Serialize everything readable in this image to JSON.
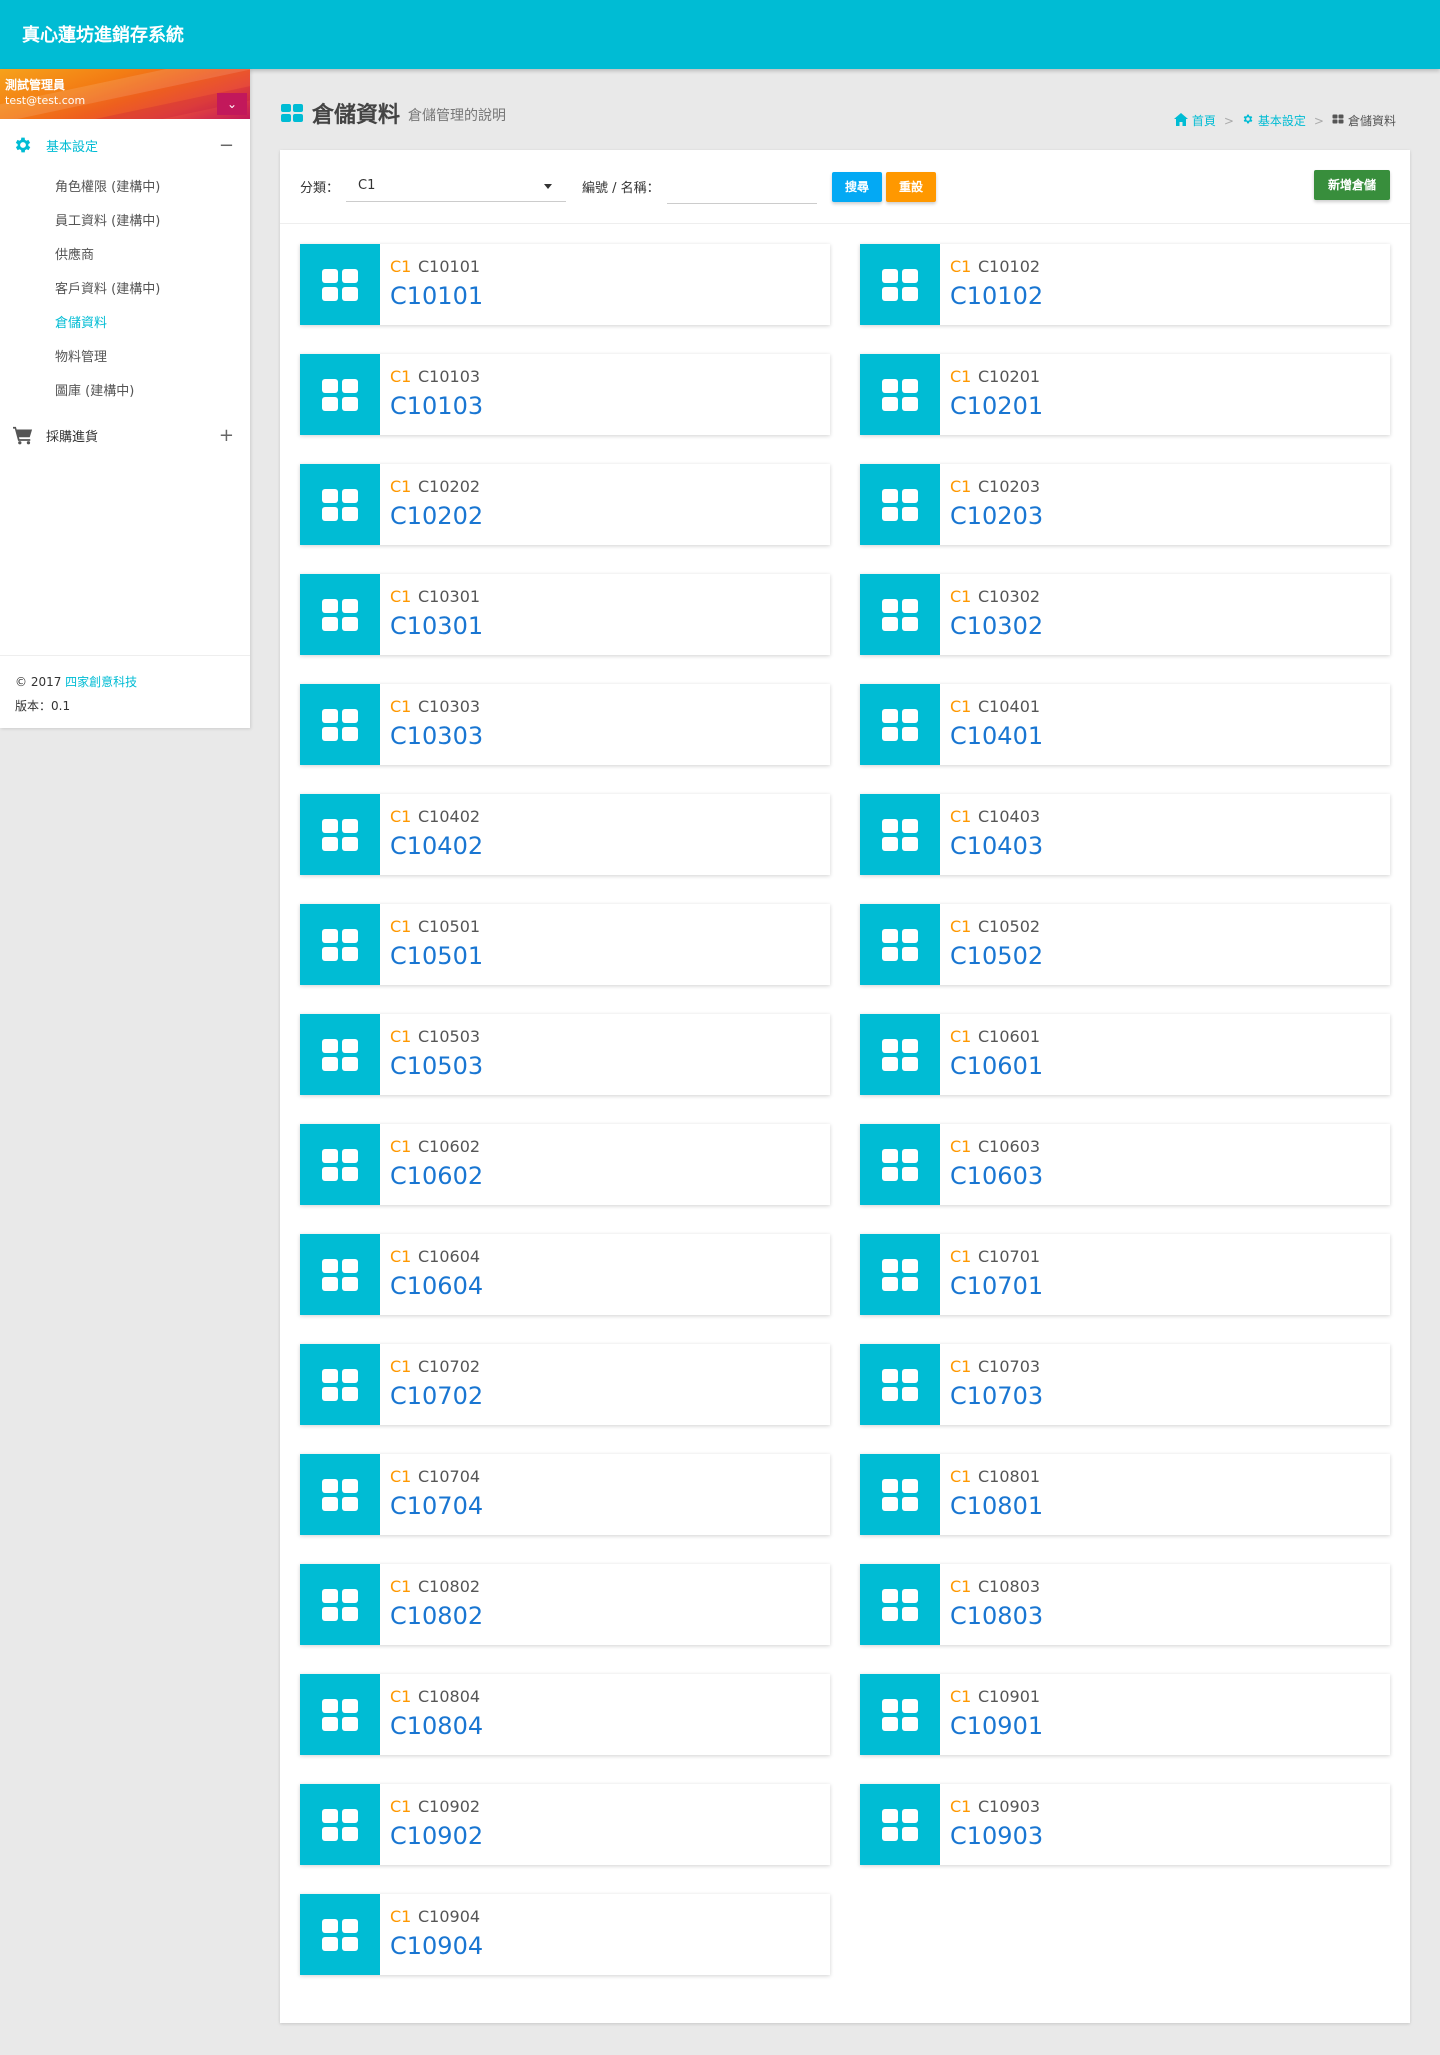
{
  "app": {
    "title": "真心蓮坊進銷存系統"
  },
  "user": {
    "name": "測試管理員",
    "email": "test@test.com"
  },
  "sidebar": {
    "groups": [
      {
        "label": "基本設定",
        "toggle": "−",
        "items": [
          {
            "label": "角色權限 (建構中)"
          },
          {
            "label": "員工資料 (建構中)"
          },
          {
            "label": "供應商"
          },
          {
            "label": "客戶資料 (建構中)"
          },
          {
            "label": "倉儲資料"
          },
          {
            "label": "物料管理"
          },
          {
            "label": "圖庫 (建構中)"
          }
        ]
      },
      {
        "label": "採購進貨",
        "toggle": "+"
      }
    ],
    "footer": {
      "copyright_prefix": "© 2017 ",
      "company": "四家創意科技",
      "version": "版本：0.1"
    }
  },
  "page": {
    "title": "倉儲資料",
    "subtitle": "倉儲管理的說明",
    "breadcrumb": {
      "home": "首頁",
      "settings": "基本設定",
      "current": "倉儲資料"
    }
  },
  "toolbar": {
    "category_label": "分類：",
    "category_value": "C1",
    "search_label": "編號 / 名稱：",
    "search_value": "",
    "search_button": "搜尋",
    "reset_button": "重設",
    "add_button": "新增倉儲"
  },
  "colors": {
    "primary": "#00bcd4",
    "accent_orange": "#ff9800",
    "link_blue": "#1976d2",
    "success_green": "#388e3c",
    "info_blue": "#03a9f4"
  },
  "warehouses": [
    {
      "category": "C1",
      "code": "C10101",
      "name": "C10101"
    },
    {
      "category": "C1",
      "code": "C10102",
      "name": "C10102"
    },
    {
      "category": "C1",
      "code": "C10103",
      "name": "C10103"
    },
    {
      "category": "C1",
      "code": "C10201",
      "name": "C10201"
    },
    {
      "category": "C1",
      "code": "C10202",
      "name": "C10202"
    },
    {
      "category": "C1",
      "code": "C10203",
      "name": "C10203"
    },
    {
      "category": "C1",
      "code": "C10301",
      "name": "C10301"
    },
    {
      "category": "C1",
      "code": "C10302",
      "name": "C10302"
    },
    {
      "category": "C1",
      "code": "C10303",
      "name": "C10303"
    },
    {
      "category": "C1",
      "code": "C10401",
      "name": "C10401"
    },
    {
      "category": "C1",
      "code": "C10402",
      "name": "C10402"
    },
    {
      "category": "C1",
      "code": "C10403",
      "name": "C10403"
    },
    {
      "category": "C1",
      "code": "C10501",
      "name": "C10501"
    },
    {
      "category": "C1",
      "code": "C10502",
      "name": "C10502"
    },
    {
      "category": "C1",
      "code": "C10503",
      "name": "C10503"
    },
    {
      "category": "C1",
      "code": "C10601",
      "name": "C10601"
    },
    {
      "category": "C1",
      "code": "C10602",
      "name": "C10602"
    },
    {
      "category": "C1",
      "code": "C10603",
      "name": "C10603"
    },
    {
      "category": "C1",
      "code": "C10604",
      "name": "C10604"
    },
    {
      "category": "C1",
      "code": "C10701",
      "name": "C10701"
    },
    {
      "category": "C1",
      "code": "C10702",
      "name": "C10702"
    },
    {
      "category": "C1",
      "code": "C10703",
      "name": "C10703"
    },
    {
      "category": "C1",
      "code": "C10704",
      "name": "C10704"
    },
    {
      "category": "C1",
      "code": "C10801",
      "name": "C10801"
    },
    {
      "category": "C1",
      "code": "C10802",
      "name": "C10802"
    },
    {
      "category": "C1",
      "code": "C10803",
      "name": "C10803"
    },
    {
      "category": "C1",
      "code": "C10804",
      "name": "C10804"
    },
    {
      "category": "C1",
      "code": "C10901",
      "name": "C10901"
    },
    {
      "category": "C1",
      "code": "C10902",
      "name": "C10902"
    },
    {
      "category": "C1",
      "code": "C10903",
      "name": "C10903"
    },
    {
      "category": "C1",
      "code": "C10904",
      "name": "C10904"
    }
  ]
}
